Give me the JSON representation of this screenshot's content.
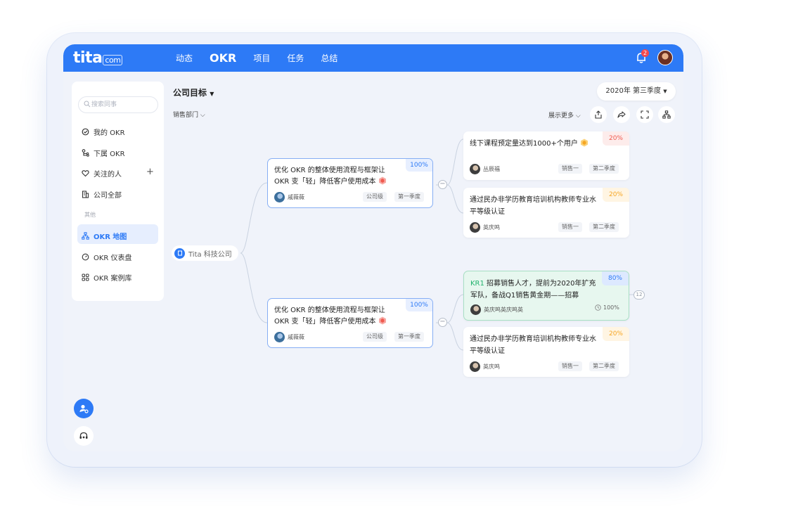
{
  "app": {
    "logo_main": "tita",
    "logo_suffix": "com",
    "notification_count": "2",
    "accent_color": "#2d7af6"
  },
  "nav": {
    "items": [
      "动态",
      "OKR",
      "项目",
      "任务",
      "总结"
    ],
    "active": "OKR"
  },
  "sidebar": {
    "search_placeholder": "搜索同事",
    "items": [
      {
        "label": "我的 OKR",
        "icon": "target-icon"
      },
      {
        "label": "下属 OKR",
        "icon": "subordinate-icon"
      },
      {
        "label": "关注的人",
        "icon": "heart-icon"
      },
      {
        "label": "公司全部",
        "icon": "building-icon"
      }
    ],
    "group_label": "其他",
    "other_items": [
      {
        "label": "OKR 地图",
        "icon": "org-chart-icon",
        "active": true
      },
      {
        "label": "OKR 仪表盘",
        "icon": "dashboard-icon"
      },
      {
        "label": "OKR 案例库",
        "icon": "grid-icon"
      }
    ],
    "add_symbol": "+"
  },
  "main": {
    "title": "公司目标",
    "department": "销售部门",
    "quarter": "2020年 第三季度",
    "show_more": "展示更多"
  },
  "map": {
    "root": "Tita 科技公司",
    "objectives": [
      {
        "line1": "优化 OKR 的整体使用流程与框架让",
        "line2": "OKR 变「轻」降低客户使用成本",
        "percent": "100%",
        "owner": "戚薇薇",
        "level": "公司级",
        "quarter": "第一季度"
      },
      {
        "line1": "优化 OKR 的整体使用流程与框架让",
        "line2": "OKR 变「轻」降低客户使用成本",
        "percent": "100%",
        "owner": "戚薇薇",
        "level": "公司级",
        "quarter": "第一季度"
      }
    ],
    "key_results": [
      {
        "line1": "线下课程预定量达到1000+个用户",
        "line2": "",
        "percent": "20%",
        "owner": "丛辰福",
        "dept": "销售一",
        "quarter": "第二季度"
      },
      {
        "line1": "通过民办非学历教育培训机构教师专业水",
        "line2": "平等级认证",
        "percent": "20%",
        "owner": "英庆鸣",
        "dept": "销售一",
        "quarter": "第二季度"
      },
      {
        "prefix": "KR1",
        "line1": " 招募销售人才，提前为2020年扩充",
        "line2": "军队，备战Q1销售黄金期——招募",
        "percent": "80%",
        "owner": "英庆鸣英庆鸣英",
        "progress": "100%",
        "child_count": "12"
      },
      {
        "line1": "通过民办非学历教育培训机构教师专业水",
        "line2": "平等级认证",
        "percent": "20%",
        "owner": "英庆鸣",
        "dept": "销售一",
        "quarter": "第二季度"
      }
    ],
    "collapse_symbol": "−"
  }
}
